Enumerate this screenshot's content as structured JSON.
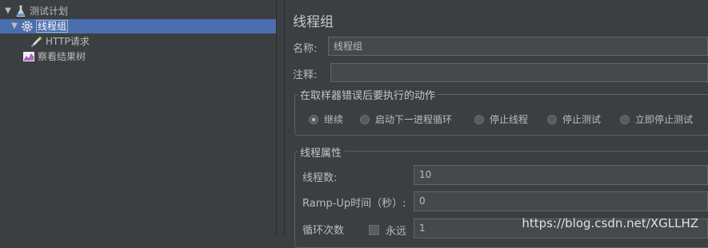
{
  "tree": {
    "items": [
      {
        "label": "测试计划",
        "icon": "flask-icon"
      },
      {
        "label": "线程组",
        "icon": "gear-icon",
        "selected": true
      },
      {
        "label": "HTTP请求",
        "icon": "pipette-icon"
      },
      {
        "label": "察看结果树",
        "icon": "chart-icon"
      }
    ]
  },
  "panel": {
    "title": "线程组",
    "name_label": "名称:",
    "name_value": "线程组",
    "comment_label": "注释:",
    "comment_value": "",
    "error_action": {
      "legend": "在取样器错误后要执行的动作",
      "options": [
        "继续",
        "启动下一进程循环",
        "停止线程",
        "停止测试",
        "立即停止测试"
      ],
      "selected_index": 0
    },
    "thread_props": {
      "legend": "线程属性",
      "threads_label": "线程数:",
      "threads_value": "10",
      "rampup_label": "Ramp-Up时间（秒）:",
      "rampup_value": "0",
      "loop_label": "循环次数",
      "forever_label": "永远",
      "forever_checked": false,
      "loop_value": "1"
    }
  },
  "watermark": "https://blog.csdn.net/XGLLHZ",
  "colors": {
    "background": "#3c3f41",
    "selection": "#4b6eaf",
    "field": "#45494a",
    "text": "#bbbbbb"
  }
}
